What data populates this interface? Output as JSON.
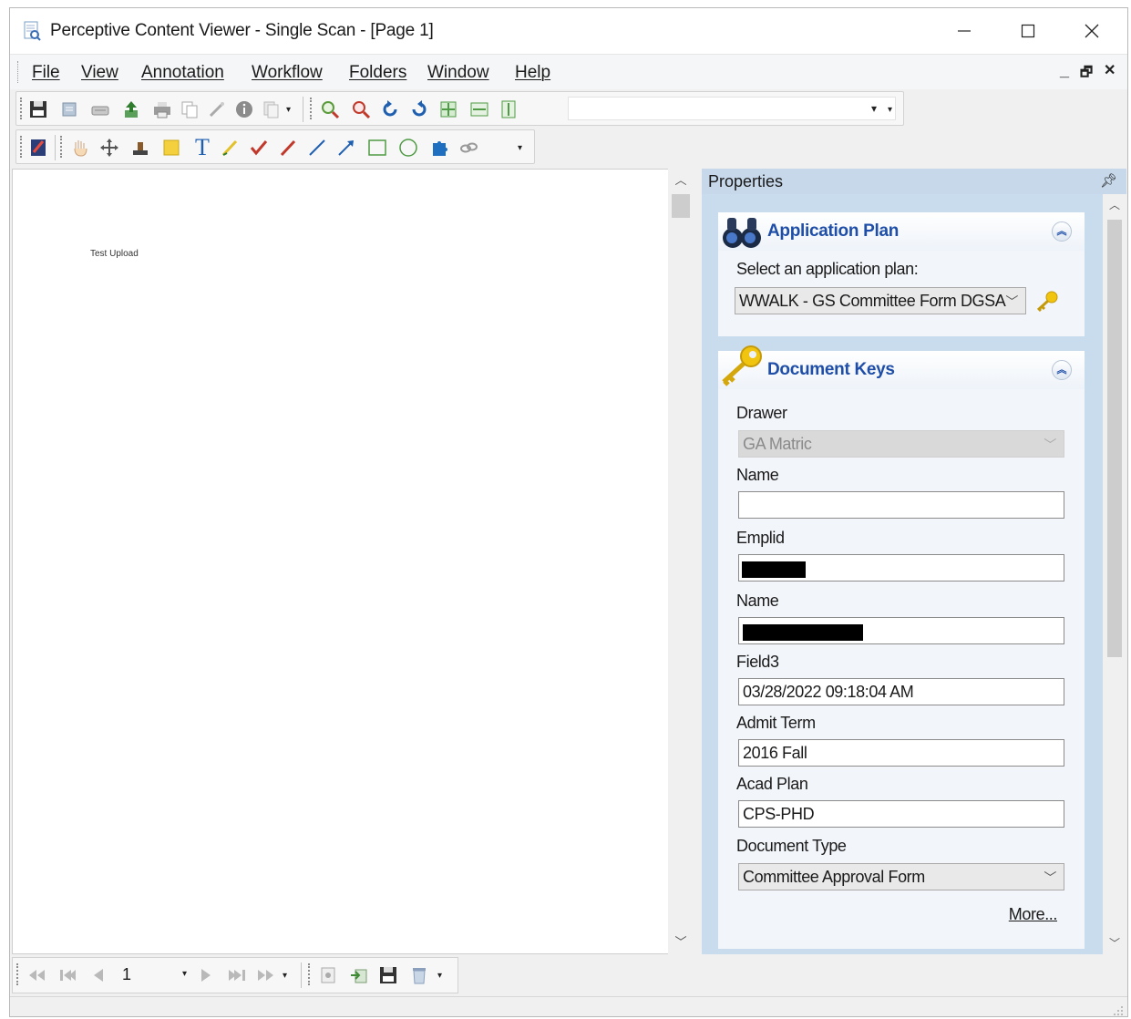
{
  "window": {
    "title": "Perceptive Content Viewer - Single Scan - [Page 1]",
    "controls": {
      "minimize": "—",
      "maximize": "☐",
      "close": "✕"
    }
  },
  "menu": {
    "items": [
      "File",
      "View",
      "Annotation",
      "Workflow",
      "Folders",
      "Window",
      "Help"
    ],
    "mdi_min": "_",
    "mdi_restore": "🗗",
    "mdi_close": "✕"
  },
  "toolbar1": {
    "icons": [
      "save-icon",
      "scan-icon",
      "scanner-icon",
      "upload-icon",
      "print-icon",
      "copy-icon",
      "wand-icon",
      "info-icon",
      "pages-icon",
      "zoom-in-icon",
      "zoom-out-icon",
      "rotate-left-icon",
      "rotate-right-icon",
      "fit-page-icon",
      "fit-width-icon",
      "fit-height-icon"
    ],
    "field_value": ""
  },
  "toolbar2": {
    "icons": [
      "annotation-icon",
      "hand-icon",
      "move-icon",
      "stamp-icon",
      "sticky-note-icon",
      "text-icon",
      "highlighter-icon",
      "checkmark-icon",
      "pen-icon",
      "line-icon",
      "arrow-icon",
      "rectangle-icon",
      "ellipse-icon",
      "puzzle-icon",
      "link-icon"
    ],
    "text_tool_label": "T"
  },
  "document": {
    "text": "Test Upload"
  },
  "properties": {
    "title": "Properties",
    "application_plan": {
      "title": "Application Plan",
      "prompt": "Select an application plan:",
      "selected": "WWALK - GS Committee Form DGSA"
    },
    "document_keys": {
      "title": "Document Keys",
      "fields": {
        "drawer_label": "Drawer",
        "drawer_value": "GA Matric",
        "name1_label": "Name",
        "name1_value": "",
        "emplid_label": "Emplid",
        "name2_label": "Name",
        "field3_label": "Field3",
        "field3_value": "03/28/2022 09:18:04 AM",
        "admit_term_label": "Admit Term",
        "admit_term_value": "2016 Fall",
        "acad_plan_label": "Acad Plan",
        "acad_plan_value": "CPS-PHD",
        "doc_type_label": "Document Type",
        "doc_type_value": "Committee Approval Form"
      },
      "more_link": "More..."
    }
  },
  "pager": {
    "page": "1"
  },
  "colors": {
    "accent_title": "#1e4ea8",
    "panel_bg": "#c9dced"
  }
}
